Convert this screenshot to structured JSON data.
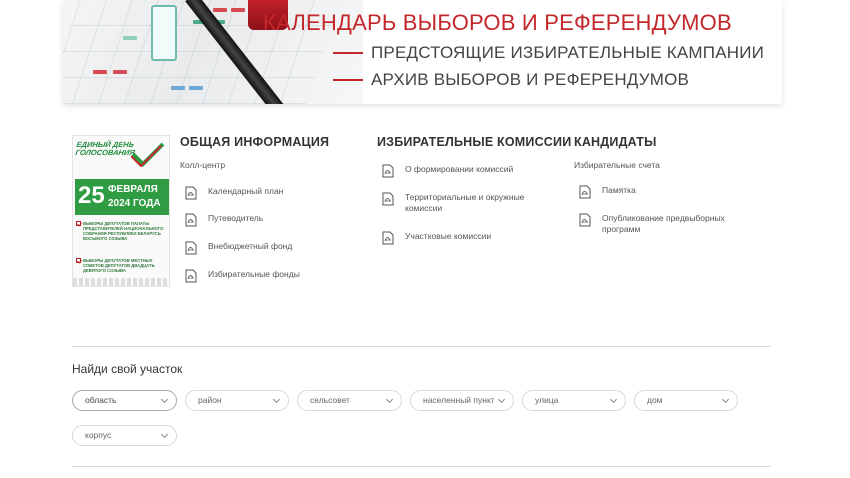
{
  "banner": {
    "title": "КАЛЕНДАРЬ ВЫБОРОВ И РЕФЕРЕНДУМОВ",
    "links": [
      "ПРЕДСТОЯЩИЕ ИЗБИРАТЕЛЬНЫЕ КАМПАНИИ",
      "АРХИВ ВЫБОРОВ И РЕФЕРЕНДУМОВ"
    ],
    "accent_color": "#c3272b"
  },
  "promo": {
    "logo_line1": "ЕДИНЫЙ ДЕНЬ",
    "logo_line2": "ГОЛОСОВАНИЯ",
    "day": "25",
    "month": "ФЕВРАЛЯ",
    "year": "2024 ГОДА",
    "item1": "ВЫБОРЫ ДЕПУТАТОВ ПАЛАТЫ ПРЕДСТАВИТЕЛЕЙ НАЦИОНАЛЬНОГО СОБРАНИЯ РЕСПУБЛИКИ БЕЛАРУСЬ ВОСЬМОГО СОЗЫВА",
    "item2": "ВЫБОРЫ ДЕПУТАТОВ МЕСТНЫХ СОВЕТОВ ДЕПУТАТОВ ДВАДЦАТЬ ДЕВЯТОГО СОЗЫВА",
    "brand_green": "#2f9c43"
  },
  "general": {
    "title": "ОБЩАЯ ИНФОРМАЦИЯ",
    "plain": "Колл-центр",
    "docs": [
      "Календарный план",
      "Путеводитель",
      "Внебюджетный фонд",
      "Избирательные фонды"
    ]
  },
  "commissions": {
    "title": "ИЗБИРАТЕЛЬНЫЕ КОМИССИИ",
    "docs": [
      "О формировании комиссий",
      "Территориальные и окружные комиссии",
      "Участковые комиссии"
    ]
  },
  "candidates": {
    "title": "КАНДИДАТЫ",
    "plain": "Избирательные счета",
    "docs": [
      "Памятка",
      "Опубликование предвыборных программ"
    ]
  },
  "search": {
    "title": "Найди свой участок",
    "fields": [
      "область",
      "район",
      "сельсовет",
      "населенный пункт",
      "улица",
      "дом",
      "корпус"
    ]
  },
  "icons": {
    "pdf": "pdf-file-icon",
    "dropdown": "chevron-down-icon"
  }
}
